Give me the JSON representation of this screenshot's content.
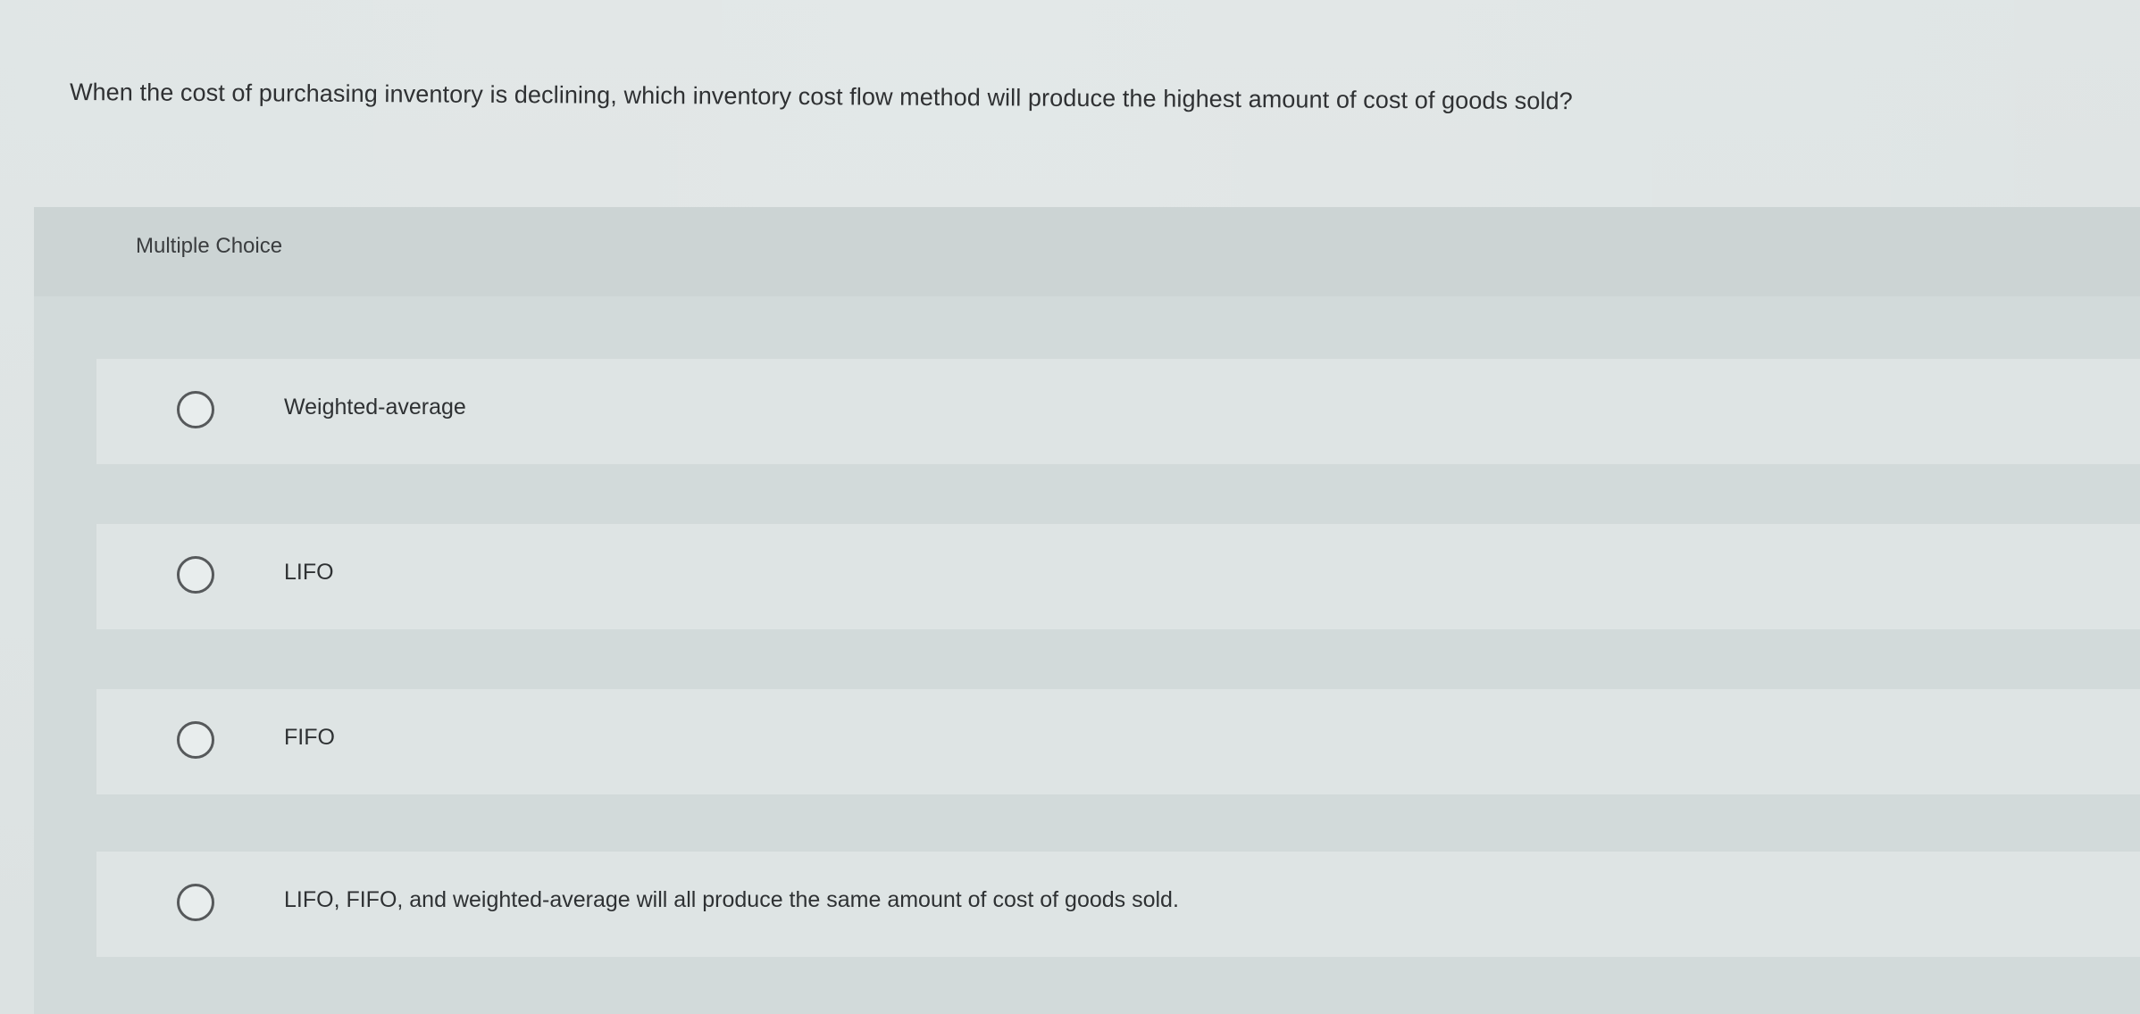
{
  "question": {
    "text": "When the cost of purchasing inventory is declining, which inventory cost flow method will produce the highest amount of cost of goods sold?"
  },
  "multiple_choice": {
    "label": "Multiple Choice",
    "options": [
      {
        "label": "Weighted-average",
        "selected": false
      },
      {
        "label": "LIFO",
        "selected": false
      },
      {
        "label": "FIFO",
        "selected": false
      },
      {
        "label": "LIFO, FIFO, and weighted-average will all produce the same amount of cost of goods sold.",
        "selected": false
      }
    ]
  }
}
